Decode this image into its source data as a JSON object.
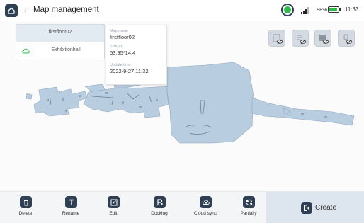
{
  "header": {
    "title": "Map management",
    "back_glyph": "←",
    "battery_percent": "88%",
    "battery_level": 0.88,
    "time": "11:33"
  },
  "map_list": [
    {
      "name": "firstfloor02",
      "selected": true
    },
    {
      "name": "Exhibitionhall",
      "selected": false,
      "icon": "cloud-icon"
    }
  ],
  "info_card": {
    "name_label": "Map name",
    "name_value": "firstfloor02",
    "size_label": "Size(m)",
    "size_value": "53.95*14.4",
    "update_label": "Update time",
    "update_value": "2022-9-27 11:32"
  },
  "map_tools": [
    {
      "name": "visibility-toggle-icon"
    },
    {
      "name": "visibility-toggle-icon"
    },
    {
      "name": "visibility-toggle-icon"
    },
    {
      "name": "visibility-toggle-icon"
    }
  ],
  "toolbar": {
    "delete": "Delete",
    "rename": "Rename",
    "edit": "Edit",
    "docking": "Docking",
    "cloud_sync": "Cloud sync",
    "partially": "Partially",
    "create": "Create"
  },
  "colors": {
    "accent_dark": "#2f4054",
    "map_fill": "#b8cde0",
    "status_green": "#2dbb4a",
    "create_bg": "#dde5ee"
  }
}
